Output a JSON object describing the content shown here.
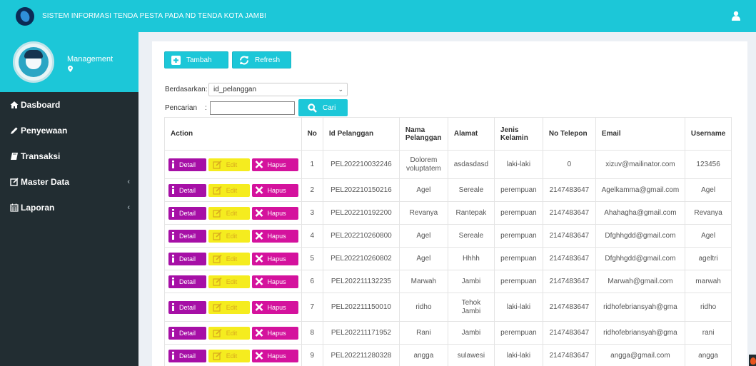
{
  "header": {
    "title": "SISTEM INFORMASI TENDA PESTA PADA ND TENDA KOTA JAMBI",
    "user_icon": "user-icon"
  },
  "sidebar": {
    "profile_name": "Management",
    "items": [
      {
        "label": "Dasboard",
        "icon": "home-icon"
      },
      {
        "label": "Penyewaan",
        "icon": "pencil-icon"
      },
      {
        "label": "Transaksi",
        "icon": "book-icon"
      },
      {
        "label": "Master Data",
        "icon": "edit-icon",
        "chevron": "‹"
      },
      {
        "label": "Laporan",
        "icon": "calendar-icon",
        "chevron": "‹"
      }
    ]
  },
  "toolbar": {
    "add_label": "Tambah",
    "refresh_label": "Refresh"
  },
  "filter": {
    "by_label": "Berdasarkan:",
    "by_value": "id_pelanggan",
    "search_label": "Pencarian",
    "search_colon": ":",
    "search_value": "",
    "search_button": "Cari"
  },
  "table": {
    "headers": {
      "action": "Action",
      "no": "No",
      "id": "Id Pelanggan",
      "nama": "Nama Pelanggan",
      "alamat": "Alamat",
      "jk": "Jenis Kelamin",
      "telp": "No Telepon",
      "email": "Email",
      "username": "Username"
    },
    "action_labels": {
      "detail": "Detail",
      "edit": "Edit",
      "hapus": "Hapus"
    },
    "rows": [
      {
        "no": "1",
        "id": "PEL202210032246",
        "nama": "Dolorem voluptatem",
        "alamat": "asdasdasd",
        "jk": "laki-laki",
        "telp": "0",
        "email": "xizuv@mailinator.com",
        "username": "123456"
      },
      {
        "no": "2",
        "id": "PEL202210150216",
        "nama": "Agel",
        "alamat": "Sereale",
        "jk": "perempuan",
        "telp": "2147483647",
        "email": "Agelkamma@gmail.com",
        "username": "Agel"
      },
      {
        "no": "3",
        "id": "PEL202210192200",
        "nama": "Revanya",
        "alamat": "Rantepak",
        "jk": "perempuan",
        "telp": "2147483647",
        "email": "Ahahagha@gmail.com",
        "username": "Revanya"
      },
      {
        "no": "4",
        "id": "PEL202210260800",
        "nama": "Agel",
        "alamat": "Sereale",
        "jk": "perempuan",
        "telp": "2147483647",
        "email": "Dfghhgdd@gmail.com",
        "username": "Agel"
      },
      {
        "no": "5",
        "id": "PEL202210260802",
        "nama": "Agel",
        "alamat": "Hhhh",
        "jk": "perempuan",
        "telp": "2147483647",
        "email": "Dfghhgdd@gmail.com",
        "username": "ageltri"
      },
      {
        "no": "6",
        "id": "PEL202211132235",
        "nama": "Marwah",
        "alamat": "Jambi",
        "jk": "perempuan",
        "telp": "2147483647",
        "email": "Marwah@gmail.com",
        "username": "marwah"
      },
      {
        "no": "7",
        "id": "PEL202211150010",
        "nama": "ridho",
        "alamat": "Tehok Jambi",
        "jk": "laki-laki",
        "telp": "2147483647",
        "email": "ridhofebriansyah@gma",
        "username": "ridho"
      },
      {
        "no": "8",
        "id": "PEL202211171952",
        "nama": "Rani",
        "alamat": "Jambi",
        "jk": "perempuan",
        "telp": "2147483647",
        "email": "ridhofebriansyah@gma",
        "username": "rani"
      },
      {
        "no": "9",
        "id": "PEL202211280328",
        "nama": "angga",
        "alamat": "sulawesi",
        "jk": "laki-laki",
        "telp": "2147483647",
        "email": "angga@gmail.com",
        "username": "angga"
      }
    ]
  },
  "colors": {
    "accent": "#1cc7d8",
    "sidebar": "#222d32",
    "detail": "#a60fa6",
    "edit": "#f5ec1f",
    "hapus": "#d4129d"
  }
}
